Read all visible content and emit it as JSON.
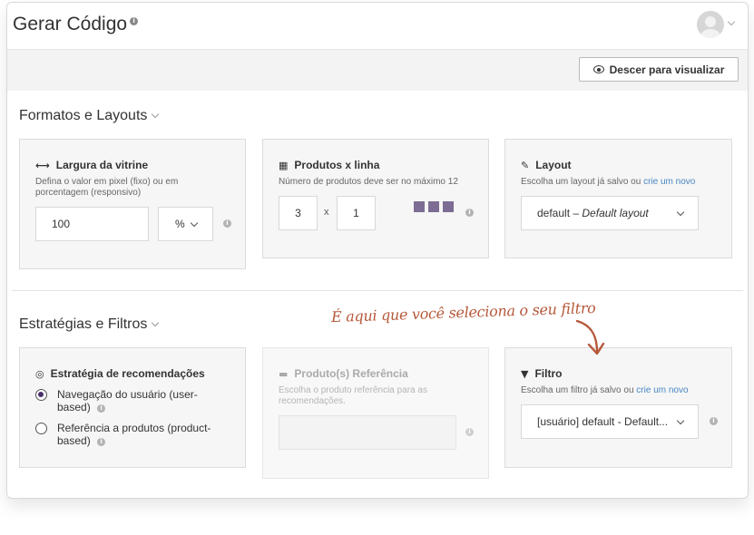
{
  "header": {
    "title": "Gerar Código"
  },
  "toolbar": {
    "view_button_label": "Descer para visualizar"
  },
  "sections": {
    "formats": {
      "title": "Formatos e Layouts"
    },
    "strategies": {
      "title": "Estratégias e Filtros"
    }
  },
  "width_panel": {
    "title": "Largura da vitrine",
    "description_line1": "Defina o valor em pixel (fixo) ou em",
    "description_line2": "porcentagem (responsivo)",
    "value": "100",
    "unit": "%"
  },
  "products_panel": {
    "title": "Produtos x linha",
    "description": "Número de produtos deve ser no máximo 12",
    "rows": "3",
    "separator": "x",
    "cols": "1"
  },
  "layout_panel": {
    "title": "Layout",
    "description": "Escolha um layout já salvo ou",
    "link": "crie um novo",
    "selected_prefix": "default –",
    "selected_italic": "Default layout"
  },
  "strategy_panel": {
    "title": "Estratégia de recomendações",
    "options": [
      {
        "label_line1": "Navegação do usuário (user-",
        "label_line2": "based)",
        "checked": true
      },
      {
        "label_line1": "Referência a produtos (product-",
        "label_line2": "based)",
        "checked": false
      }
    ]
  },
  "reference_panel": {
    "title": "Produto(s) Referência",
    "description_line1": "Escolha o produto referência para as",
    "description_line2": "recomendações."
  },
  "filter_panel": {
    "title": "Filtro",
    "description": "Escolha um filtro já salvo ou",
    "link": "crie um novo",
    "selected": "[usuário] default - Default..."
  },
  "annotation": {
    "text": "É aqui que você seleciona o seu filtro"
  },
  "colors": {
    "accent": "#7d6d94",
    "annotation": "#b5583a",
    "link": "#4a86c5"
  }
}
